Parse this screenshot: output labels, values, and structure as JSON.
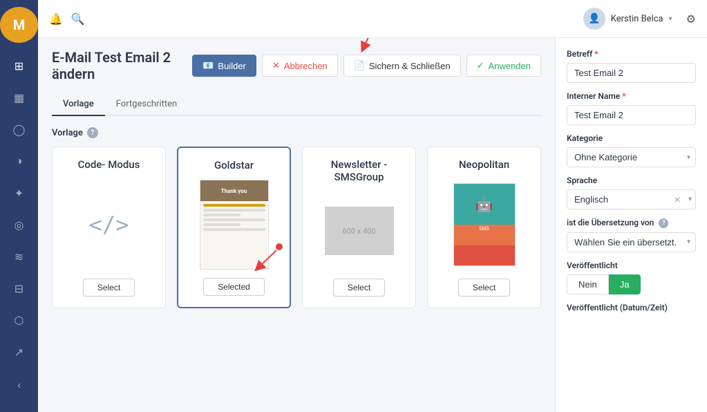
{
  "app": {
    "logo": "M"
  },
  "sidebar": {
    "icons": [
      {
        "name": "grid-icon",
        "symbol": "⊞"
      },
      {
        "name": "calendar-icon",
        "symbol": "📅"
      },
      {
        "name": "user-icon",
        "symbol": "👤"
      },
      {
        "name": "chart-icon",
        "symbol": "📊"
      },
      {
        "name": "puzzle-icon",
        "symbol": "🧩"
      },
      {
        "name": "clock-icon",
        "symbol": "⏰"
      },
      {
        "name": "feed-icon",
        "symbol": "📡"
      },
      {
        "name": "table-icon",
        "symbol": "⊟"
      },
      {
        "name": "paint-icon",
        "symbol": "🎨"
      },
      {
        "name": "trend-icon",
        "symbol": "📈"
      },
      {
        "name": "collapse-icon",
        "symbol": "‹"
      }
    ]
  },
  "topnav": {
    "bell_icon": "🔔",
    "search_icon": "🔍",
    "user_name": "Kerstin Belca",
    "gear_icon": "⚙"
  },
  "page": {
    "title": "E-Mail Test Email 2 ändern",
    "tabs": [
      {
        "label": "Vorlage",
        "active": true
      },
      {
        "label": "Fortgeschritten",
        "active": false
      }
    ],
    "section_label": "Vorlage",
    "buttons": {
      "builder": "Builder",
      "cancel": "Abbrechen",
      "save": "Sichern & Schließen",
      "apply": "Anwenden"
    }
  },
  "templates": [
    {
      "id": "code-modus",
      "title": "Code-\nModus",
      "preview_type": "code",
      "button_label": "Select",
      "selected": false
    },
    {
      "id": "goldstar",
      "title": "Goldstar",
      "preview_type": "goldstar",
      "button_label": "Selected",
      "selected": true
    },
    {
      "id": "newsletter-smsgroup",
      "title": "Newsletter -\nSMSGroup",
      "preview_type": "placeholder",
      "preview_text": "600 x 400",
      "button_label": "Select",
      "selected": false
    },
    {
      "id": "neopolitan",
      "title": "Neopolitan",
      "preview_type": "neopolitan",
      "button_label": "Select",
      "selected": false
    }
  ],
  "right_panel": {
    "betreff_label": "Betreff",
    "betreff_value": "Test Email 2",
    "interner_name_label": "Interner Name",
    "interner_name_value": "Test Email 2",
    "kategorie_label": "Kategorie",
    "kategorie_value": "Ohne Kategorie",
    "sprache_label": "Sprache",
    "sprache_value": "Englisch",
    "ubersetzung_label": "ist die Übersetzung von",
    "ubersetzung_value": "Wählen Sie ein übersetzt...",
    "veroffentlicht_label": "Veröffentlicht",
    "veroffentlicht_nein": "Nein",
    "veroffentlicht_ja": "Ja",
    "veroffentlicht_datum_label": "Veröffentlicht (Datum/Zeit)"
  }
}
